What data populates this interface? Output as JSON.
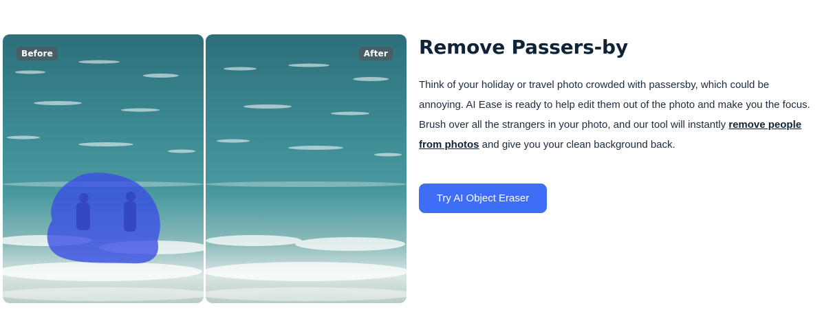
{
  "compare": {
    "before_label": "Before",
    "after_label": "After"
  },
  "section": {
    "title": "Remove Passers-by",
    "description_before_link": "Think of your holiday or travel photo crowded with passersby, which could be annoying. AI Ease is ready to help edit them out of the photo and make you the focus. Brush over all the strangers in your photo, and our tool will instantly ",
    "link_text": "remove people from photos",
    "description_after_link": " and give you your clean background back.",
    "cta_label": "Try AI Object Eraser"
  },
  "colors": {
    "cta_background": "#3f6df6",
    "title_text": "#0f2236",
    "brush_overlay": "#3a4de6"
  }
}
